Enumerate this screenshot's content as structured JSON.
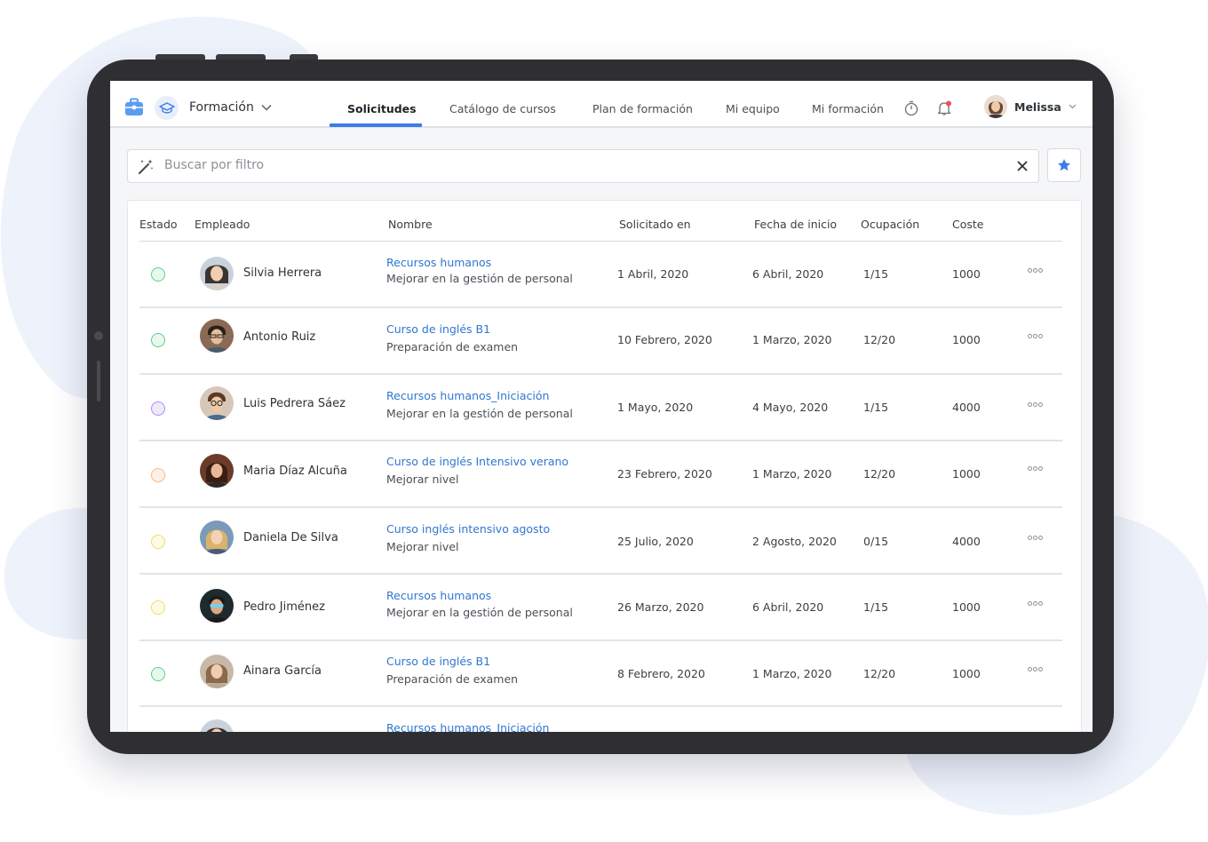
{
  "colors": {
    "accent": "#3d7ce8",
    "link": "#2f77d0",
    "status_green": "#5bd08a",
    "status_purple": "#a990f0",
    "status_orange": "#f5b98a",
    "status_yellow": "#ecdf63"
  },
  "nav": {
    "module": "Formación",
    "tabs": [
      "Solicitudes",
      "Catálogo de cursos",
      "Plan de formación",
      "Mi equipo",
      "Mi formación"
    ],
    "user": "Melissa",
    "icons": [
      "briefcase-icon",
      "graduation-cap-icon",
      "chevron-down-icon",
      "timer-icon",
      "bell-icon",
      "star-icon",
      "magic-wand-icon",
      "close-icon"
    ]
  },
  "search": {
    "placeholder": "Buscar por filtro"
  },
  "table": {
    "headers": [
      "Estado",
      "Empleado",
      "Nombre",
      "Solicitado en",
      "Fecha de inicio",
      "Ocupación",
      "Coste"
    ],
    "rows": [
      {
        "status": "green",
        "employee": "Silvia Herrera",
        "course": "Recursos humanos",
        "description": "Mejorar en la gestión de personal",
        "requested": "1 Abril, 2020",
        "start": "6 Abril, 2020",
        "occupancy": "1/15",
        "cost": "1000"
      },
      {
        "status": "green",
        "employee": "Antonio Ruiz",
        "course": "Curso de inglés B1",
        "description": "Preparación de examen",
        "requested": "10 Febrero, 2020",
        "start": "1 Marzo, 2020",
        "occupancy": "12/20",
        "cost": "1000"
      },
      {
        "status": "purple",
        "employee": "Luis Pedrera Sáez",
        "course": "Recursos humanos_Iniciación",
        "description": "Mejorar en la gestión de personal",
        "requested": "1 Mayo, 2020",
        "start": "4 Mayo, 2020",
        "occupancy": "1/15",
        "cost": "4000"
      },
      {
        "status": "orange",
        "employee": "Maria Díaz Alcuña",
        "course": "Curso de inglés Intensivo verano",
        "description": "Mejorar nivel",
        "requested": "23 Febrero, 2020",
        "start": "1 Marzo, 2020",
        "occupancy": "12/20",
        "cost": "1000"
      },
      {
        "status": "yellow",
        "employee": "Daniela De Silva",
        "course": "Curso inglés intensivo agosto",
        "description": "Mejorar nivel",
        "requested": "25 Julio, 2020",
        "start": "2 Agosto, 2020",
        "occupancy": "0/15",
        "cost": "4000"
      },
      {
        "status": "yellow",
        "employee": "Pedro Jiménez",
        "course": "Recursos humanos",
        "description": "Mejorar en la gestión de personal",
        "requested": "26 Marzo, 2020",
        "start": "6 Abril, 2020",
        "occupancy": "1/15",
        "cost": "1000"
      },
      {
        "status": "green",
        "employee": "Ainara García",
        "course": "Curso de inglés B1",
        "description": "Preparación de examen",
        "requested": "8 Febrero, 2020",
        "start": "1 Marzo, 2020",
        "occupancy": "12/20",
        "cost": "1000"
      },
      {
        "status": "",
        "employee": "",
        "course": "Recursos humanos_Iniciación",
        "description": "",
        "requested": "",
        "start": "",
        "occupancy": "",
        "cost": ""
      }
    ]
  }
}
